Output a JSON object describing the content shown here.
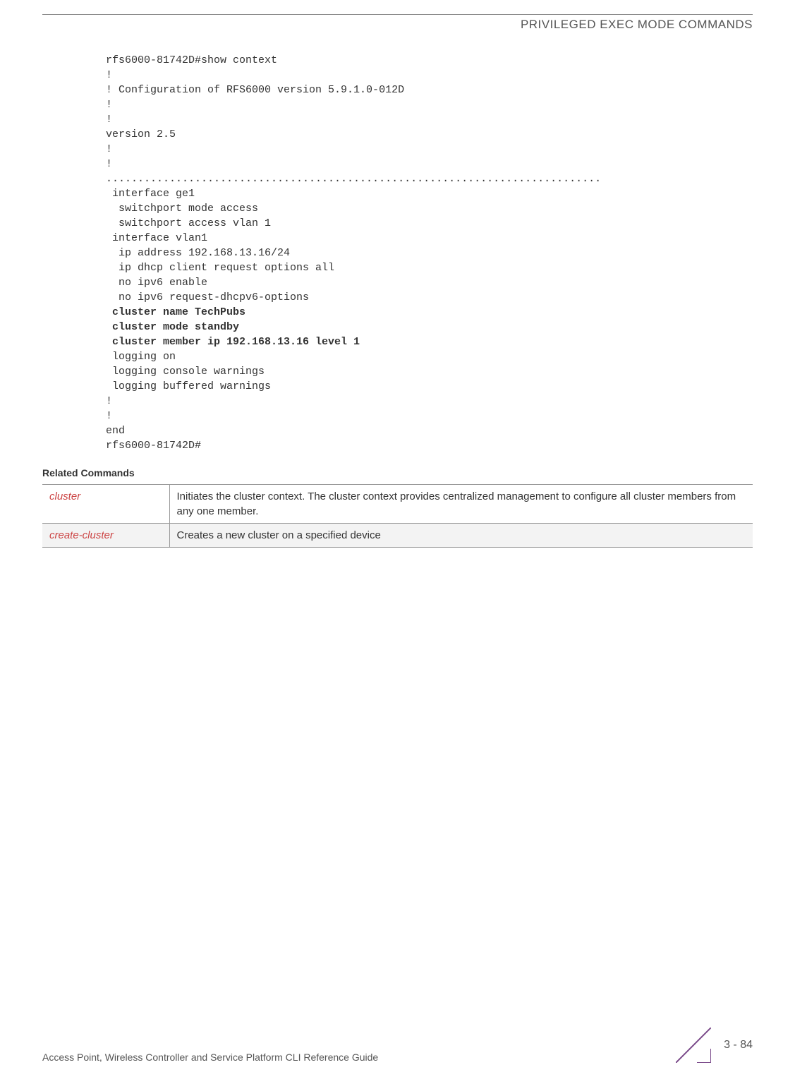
{
  "header": {
    "title": "PRIVILEGED EXEC MODE COMMANDS"
  },
  "code": {
    "l1": "rfs6000-81742D#show context",
    "l2": "!",
    "l3": "! Configuration of RFS6000 version 5.9.1.0-012D",
    "l4": "!",
    "l5": "!",
    "l6": "version 2.5",
    "l7": "!",
    "l8": "!",
    "l9": "..............................................................................",
    "l10": " interface ge1",
    "l11": "  switchport mode access",
    "l12": "  switchport access vlan 1",
    "l13": " interface vlan1",
    "l14": "  ip address 192.168.13.16/24",
    "l15": "  ip dhcp client request options all",
    "l16": "  no ipv6 enable",
    "l17": "  no ipv6 request-dhcpv6-options",
    "l18": " cluster name TechPubs",
    "l19": " cluster mode standby",
    "l20": " cluster member ip 192.168.13.16 level 1",
    "l21": " logging on",
    "l22": " logging console warnings",
    "l23": " logging buffered warnings",
    "l24": "!",
    "l25": "!",
    "l26": "end",
    "l27": "rfs6000-81742D#"
  },
  "section": {
    "heading": "Related Commands"
  },
  "table": {
    "rows": [
      {
        "cmd": "cluster",
        "desc": "Initiates the cluster context. The cluster context provides centralized management to configure all cluster members from any one member."
      },
      {
        "cmd": "create-cluster",
        "desc": "Creates a new cluster on a specified device"
      }
    ]
  },
  "footer": {
    "left": "Access Point, Wireless Controller and Service Platform CLI Reference Guide",
    "page": "3 - 84"
  }
}
